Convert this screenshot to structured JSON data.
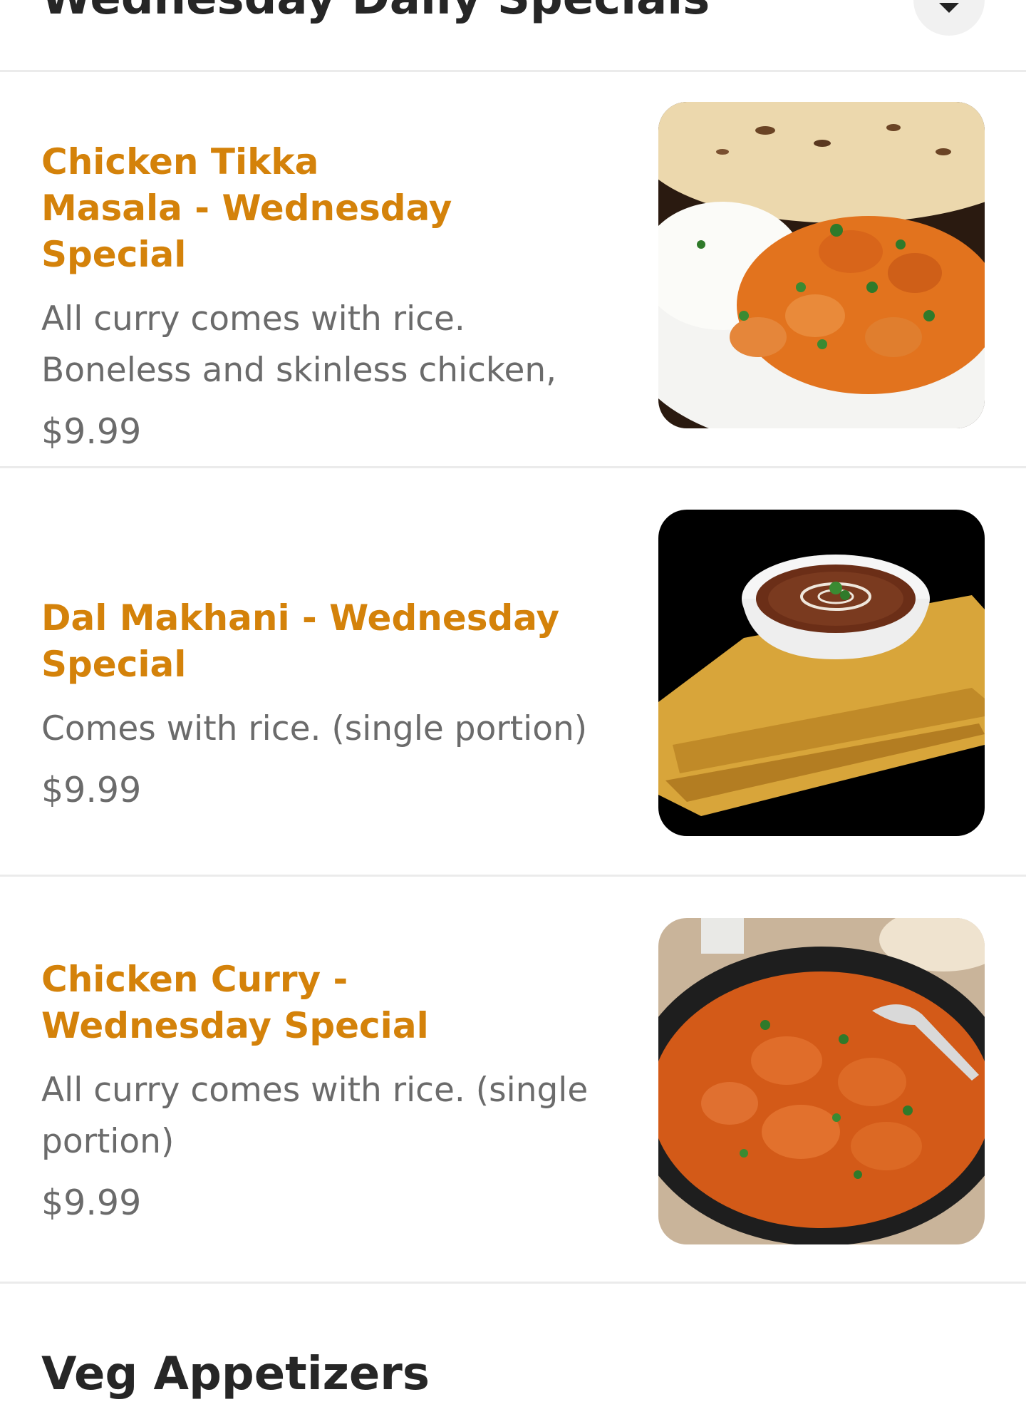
{
  "section": {
    "title": "Wednesday Daily Specials"
  },
  "items": [
    {
      "name": "Chicken Tikka Masala - Wednesday Special",
      "description": "All curry comes with rice. Boneless and skinless chicken, pl...",
      "price": "$9.99"
    },
    {
      "name": "Dal Makhani - Wednesday Special",
      "description": "Comes with rice. (single portion)",
      "price": "$9.99"
    },
    {
      "name": "Chicken Curry - Wednesday Special",
      "description": "All curry comes with rice. (single portion)",
      "price": "$9.99"
    }
  ],
  "next_section": {
    "title": "Veg Appetizers"
  },
  "colors": {
    "item_name": "#d4820a",
    "text_secondary": "#6b6b6b",
    "heading": "#262626",
    "divider": "#ebebeb"
  },
  "icons": {
    "collapse": "chevron-down-icon"
  }
}
